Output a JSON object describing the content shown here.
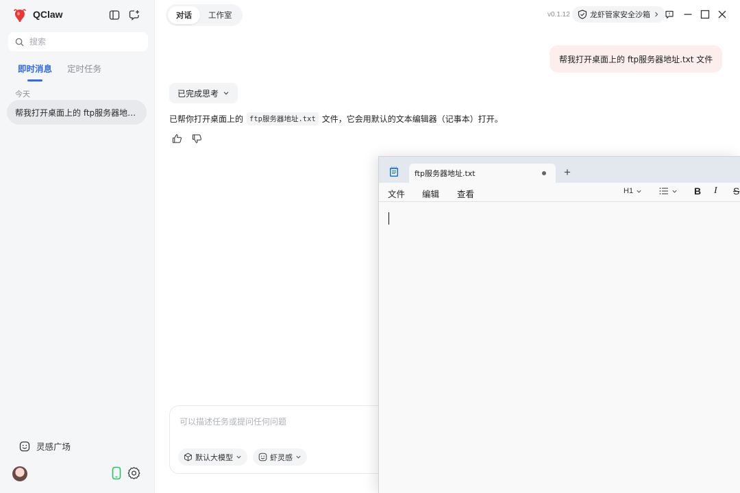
{
  "app": {
    "name": "QClaw",
    "version": "v0.1.12"
  },
  "sidebar": {
    "search_placeholder": "搜索",
    "tabs": [
      {
        "label": "即时消息",
        "active": true
      },
      {
        "label": "定时任务",
        "active": false
      }
    ],
    "group_label": "今天",
    "conversations": [
      {
        "title": "帮我打开桌面上的 ftp服务器地址.txt 文件"
      }
    ],
    "inspire_label": "灵感广场"
  },
  "header": {
    "segments": [
      {
        "label": "对话",
        "active": true
      },
      {
        "label": "工作室",
        "active": false
      }
    ],
    "sandbox_label": "龙虾管家安全沙箱"
  },
  "chat": {
    "user_message": "帮我打开桌面上的 ftp服务器地址.txt 文件",
    "thinking_label": "已完成思考",
    "reply_prefix": "已帮你打开桌面上的",
    "reply_filename": "ftp服务器地址.txt",
    "reply_suffix": "文件，它会用默认的文本编辑器（记事本）打开。"
  },
  "composer": {
    "placeholder": "可以描述任务或提问任何问题",
    "model_label": "默认大模型",
    "inspiration_label": "虾灵感"
  },
  "notepad": {
    "tab_title": "ftp服务器地址.txt",
    "menus": [
      "文件",
      "编辑",
      "查看"
    ],
    "heading_label": "H1",
    "bold_label": "B",
    "italic_label": "I",
    "strike_label": "S",
    "content": ""
  },
  "colors": {
    "accent": "#2f68f3",
    "user_bubble": "#fdeeee",
    "sidebar_bg": "#f5f6f8",
    "device_green": "#22c55e",
    "logo_red": "#e53935"
  },
  "icons": {
    "logo": "qclaw-lobster-logo",
    "sidebar_toggle": "sidebar-toggle-icon",
    "new_chat": "new-chat-icon",
    "search": "search-icon",
    "inspire": "smiley-icon",
    "phone": "phone-icon",
    "settings": "gear-icon",
    "sandbox": "shield-icon",
    "feedback": "feedback-icon",
    "thumbs_up": "thumbs-up-icon",
    "thumbs_down": "thumbs-down-icon",
    "model": "cube-icon",
    "notepad": "notepad-icon"
  }
}
